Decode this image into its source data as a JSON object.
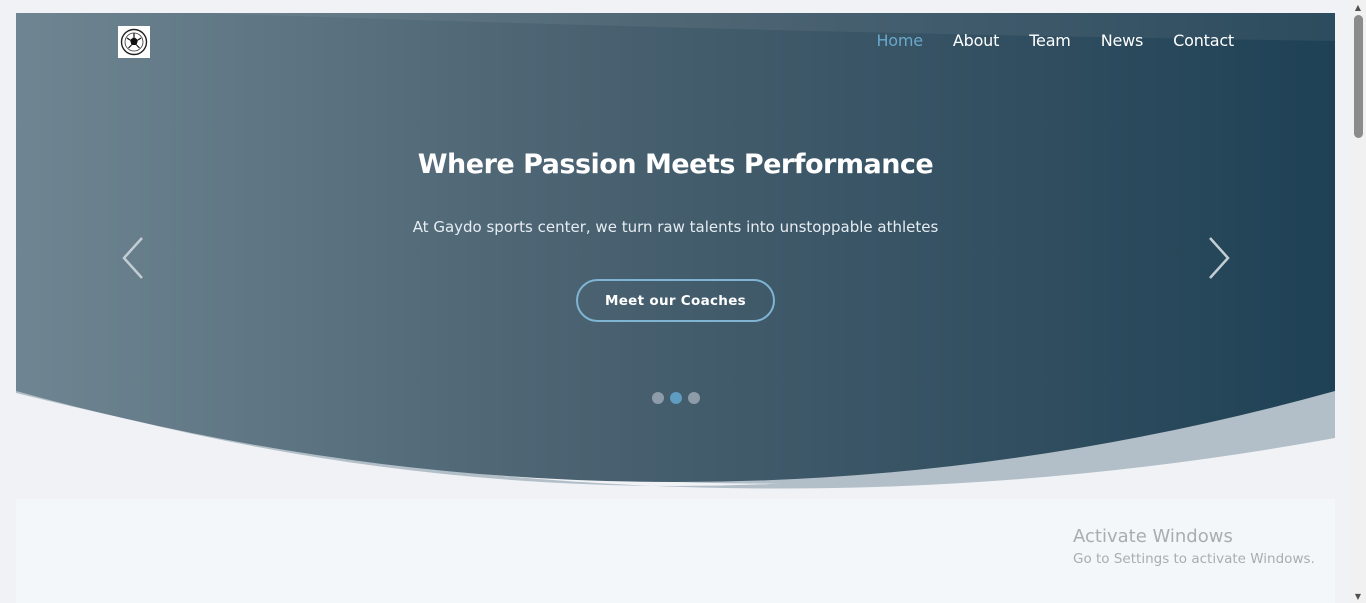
{
  "header": {
    "logo_icon": "soccer-ball-logo-icon",
    "nav": [
      {
        "label": "Home",
        "active": true
      },
      {
        "label": "About",
        "active": false
      },
      {
        "label": "Team",
        "active": false
      },
      {
        "label": "News",
        "active": false
      },
      {
        "label": "Contact",
        "active": false
      }
    ]
  },
  "hero": {
    "title": "Where Passion Meets Performance",
    "subtitle": "At Gaydo sports center, we turn raw talents into unstoppable athletes",
    "cta_label": "Meet our Coaches",
    "prev_icon": "chevron-left-icon",
    "next_icon": "chevron-right-icon",
    "slides_total": 3,
    "active_slide": 2
  },
  "watermark": {
    "title": "Activate Windows",
    "subtitle": "Go to Settings to activate Windows."
  },
  "colors": {
    "hero_gradient_start": "#6f8592",
    "hero_gradient_end": "#1f4155",
    "nav_active": "#6aa8cc",
    "cta_border": "#7fb4d2",
    "page_background": "#f1f2f6"
  }
}
